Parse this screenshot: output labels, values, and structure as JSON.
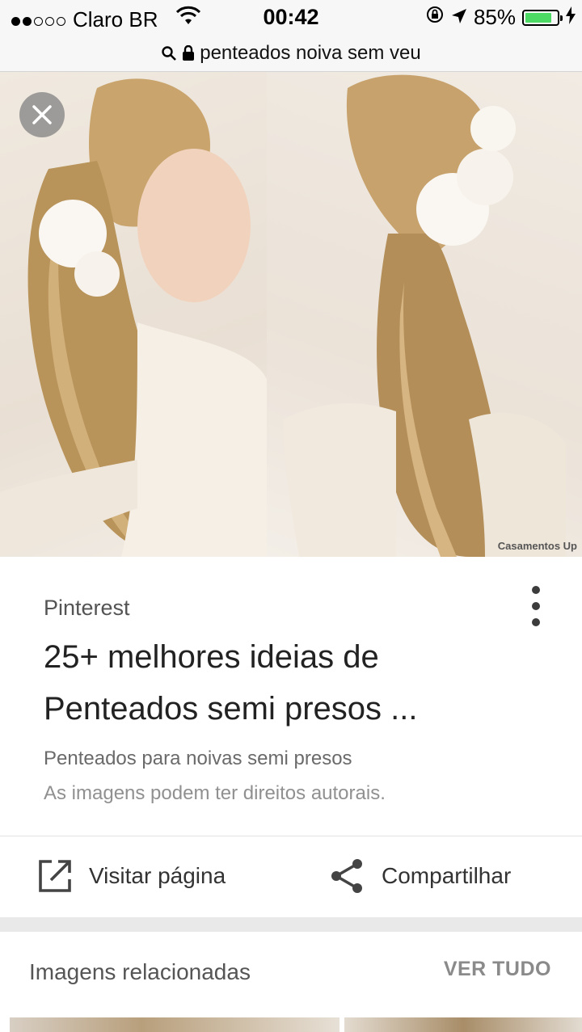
{
  "status_bar": {
    "carrier": "Claro BR",
    "time": "00:42",
    "battery": "85%",
    "battery_level": 0.85
  },
  "url_bar": {
    "query": "penteados noiva sem veu"
  },
  "image": {
    "watermark": "Casamentos Up"
  },
  "result": {
    "source": "Pinterest",
    "title": "25+ melhores ideias de Penteados semi presos ...",
    "caption": "Penteados para noivas semi presos",
    "rights_notice": "As imagens podem ter direitos autorais.",
    "visit_label": "Visitar página",
    "share_label": "Compartilhar"
  },
  "related": {
    "title": "Imagens relacionadas",
    "see_all": "VER TUDO"
  },
  "colors": {
    "battery_green": "#4cd964",
    "text_dark": "#222222",
    "text_muted": "#6a6a6a"
  }
}
